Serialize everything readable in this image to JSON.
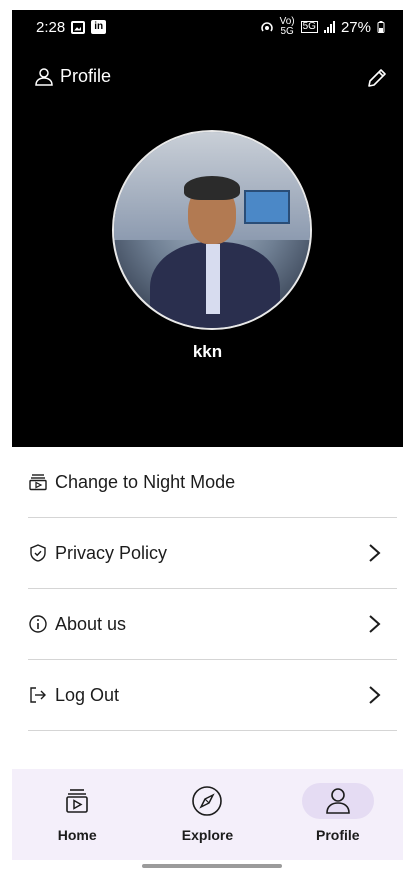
{
  "status_bar": {
    "time": "2:28",
    "network_small_top": "Vo)",
    "network_small_bottom": "5G",
    "network_5g": "5G",
    "battery": "27%"
  },
  "header": {
    "title": "Profile",
    "user_name": "kkn"
  },
  "menu": [
    {
      "label": "Change to Night Mode",
      "icon": "night-mode-icon",
      "chevron": false
    },
    {
      "label": "Privacy Policy",
      "icon": "shield-check-icon",
      "chevron": true
    },
    {
      "label": "About us",
      "icon": "info-icon",
      "chevron": true
    },
    {
      "label": "Log Out",
      "icon": "logout-icon",
      "chevron": true
    }
  ],
  "bottom_nav": [
    {
      "label": "Home",
      "icon": "home-feed-icon",
      "active": false
    },
    {
      "label": "Explore",
      "icon": "compass-icon",
      "active": false
    },
    {
      "label": "Profile",
      "icon": "user-icon",
      "active": true
    }
  ],
  "colors": {
    "header_bg": "#000000",
    "nav_bg": "#f4effa",
    "nav_active_pill": "#e5dcf3",
    "divider": "#d5d5d5"
  }
}
